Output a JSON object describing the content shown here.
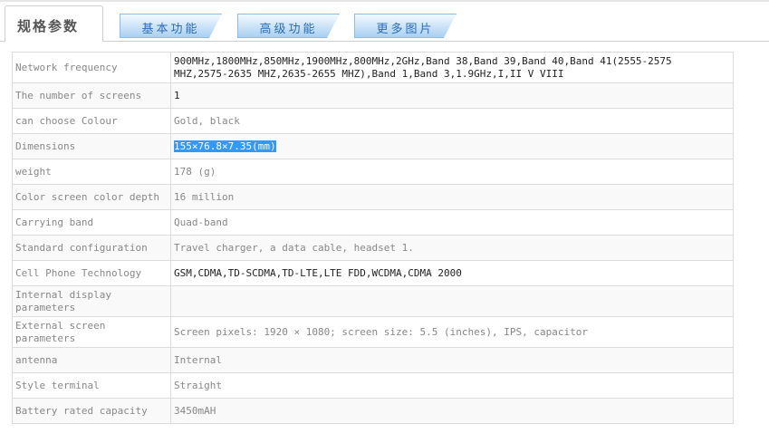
{
  "tabs": [
    {
      "label": "规格参数",
      "active": true
    },
    {
      "label": "基本功能",
      "active": false
    },
    {
      "label": "高级功能",
      "active": false
    },
    {
      "label": "更多图片",
      "active": false
    }
  ],
  "specs": [
    {
      "key": "Network frequency",
      "value": "900MHz,1800MHz,850MHz,1900MHz,800MHz,2GHz,Band 38,Band 39,Band 40,Band 41(2555-2575 MHZ,2575-2635 MHZ,2635-2655 MHZ),Band 1,Band 3,1.9GHz,I,II V VIII"
    },
    {
      "key": "The number of screens",
      "value": "1"
    },
    {
      "key": "can choose Colour",
      "value": "Gold, black"
    },
    {
      "key": "Dimensions",
      "value": "155×76.8×7.35(mm)"
    },
    {
      "key": "weight",
      "value": "178 (g)"
    },
    {
      "key": "Color screen color depth",
      "value": "16 million"
    },
    {
      "key": "Carrying band",
      "value": "Quad-band"
    },
    {
      "key": "Standard configuration",
      "value": "Travel charger, a data cable, headset 1."
    },
    {
      "key": "Cell Phone Technology",
      "value": "GSM,CDMA,TD-SCDMA,TD-LTE,LTE FDD,WCDMA,CDMA 2000"
    },
    {
      "key": "Internal display parameters",
      "value": ""
    },
    {
      "key": "External screen parameters",
      "value": "Screen pixels: 1920 × 1080; screen size: 5.5 (inches), IPS, capacitor"
    },
    {
      "key": "antenna",
      "value": "Internal"
    },
    {
      "key": "Style terminal",
      "value": "Straight"
    },
    {
      "key": "Battery rated capacity",
      "value": "3450mAH"
    }
  ]
}
